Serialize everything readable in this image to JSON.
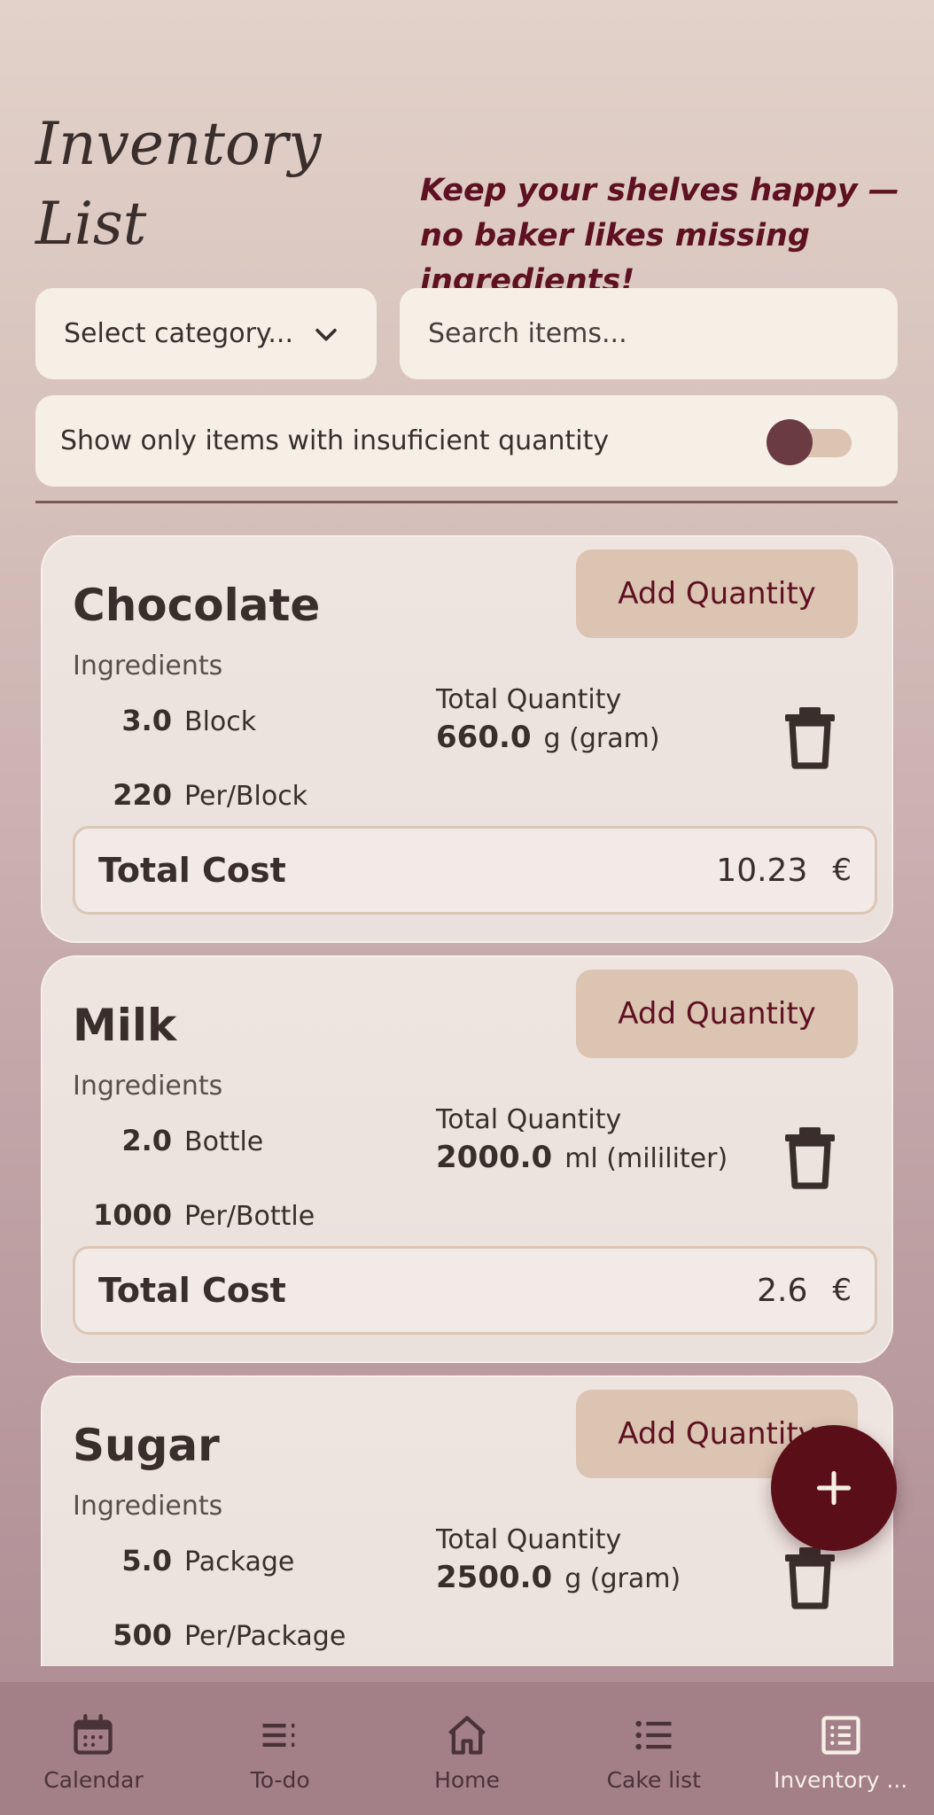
{
  "header": {
    "title": "Inventory List",
    "tagline": "Keep your shelves happy — no baker likes missing ingredients!"
  },
  "filters": {
    "category_placeholder": "Select category...",
    "search_placeholder": "Search items...",
    "insufficient_label": "Show only items with insuficient quantity",
    "insufficient_on": false
  },
  "items": [
    {
      "name": "Chocolate",
      "category": "Ingredients",
      "add_label": "Add Quantity",
      "packages": "3.0",
      "package_unit": "Block",
      "per_package": "220",
      "per_unit": "Per/Block",
      "total_label": "Total Quantity",
      "total_qty": "660.0",
      "total_unit": "g (gram)",
      "cost_label": "Total Cost",
      "cost": "10.23",
      "currency": "€"
    },
    {
      "name": "Milk",
      "category": "Ingredients",
      "add_label": "Add Quantity",
      "packages": "2.0",
      "package_unit": "Bottle",
      "per_package": "1000",
      "per_unit": "Per/Bottle",
      "total_label": "Total Quantity",
      "total_qty": "2000.0",
      "total_unit": "ml (mililiter)",
      "cost_label": "Total Cost",
      "cost": "2.6",
      "currency": "€"
    },
    {
      "name": "Sugar",
      "category": "Ingredients",
      "add_label": "Add Quantity",
      "packages": "5.0",
      "package_unit": "Package",
      "per_package": "500",
      "per_unit": "Per/Package",
      "total_label": "Total Quantity",
      "total_qty": "2500.0",
      "total_unit": "g (gram)"
    }
  ],
  "fab": {
    "icon": "plus-icon"
  },
  "nav": [
    {
      "label": "Calendar",
      "icon": "calendar-icon"
    },
    {
      "label": "To-do",
      "icon": "todo-icon"
    },
    {
      "label": "Home",
      "icon": "home-icon"
    },
    {
      "label": "Cake list",
      "icon": "list-icon"
    },
    {
      "label": "Inventory ...",
      "icon": "inventory-icon"
    }
  ],
  "colors": {
    "accent": "#5a0e18",
    "tagline": "#5e1120",
    "button": "#dcc4b3",
    "field": "#f6efe6",
    "nav_bg": "#a37f87"
  }
}
